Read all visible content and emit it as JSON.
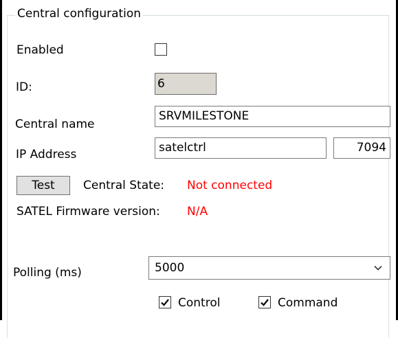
{
  "group": {
    "title": "Central configuration"
  },
  "enabled": {
    "label": "Enabled",
    "checked": false
  },
  "id": {
    "label": "ID:",
    "value": "6"
  },
  "central_name": {
    "label": "Central name",
    "value": "SRVMILESTONE"
  },
  "ip_address": {
    "label": "IP Address",
    "host": "satelctrl",
    "port": "7094"
  },
  "test": {
    "button_label": "Test",
    "state_label": "Central State:",
    "state_value": "Not connected",
    "status_color": "#ff0000"
  },
  "firmware": {
    "label": "SATEL Firmware version:",
    "value": "N/A"
  },
  "polling": {
    "label": "Polling (ms)",
    "value": "5000",
    "icon": "chevron-down-icon"
  },
  "options": {
    "control_label": "Control",
    "control_checked": true,
    "command_label": "Command",
    "command_checked": true
  }
}
